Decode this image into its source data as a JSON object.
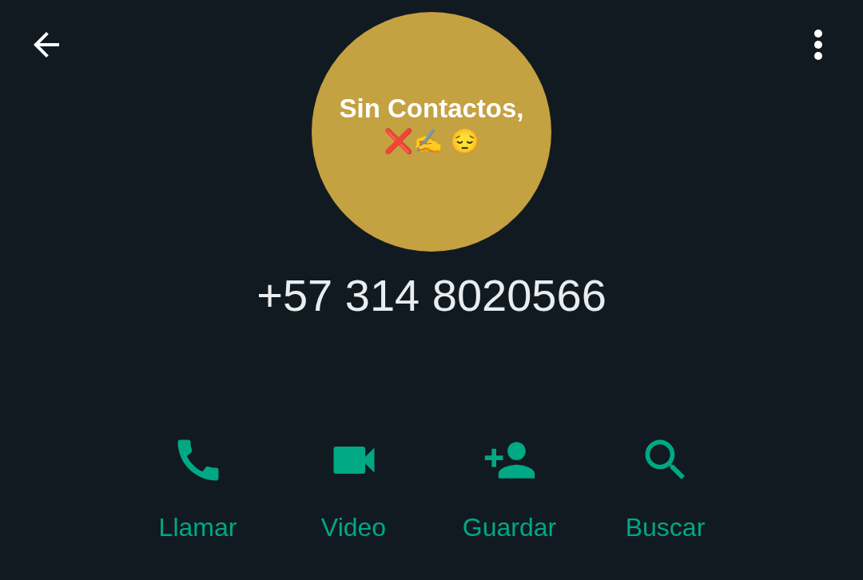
{
  "avatar": {
    "lines": [
      "Sin Contactos,",
      "❌✍️ 😔"
    ]
  },
  "phone_number": "+57 314 8020566",
  "actions": [
    {
      "kind": "call",
      "label": "Llamar"
    },
    {
      "kind": "video",
      "label": "Video"
    },
    {
      "kind": "save",
      "label": "Guardar"
    },
    {
      "kind": "search",
      "label": "Buscar"
    }
  ]
}
